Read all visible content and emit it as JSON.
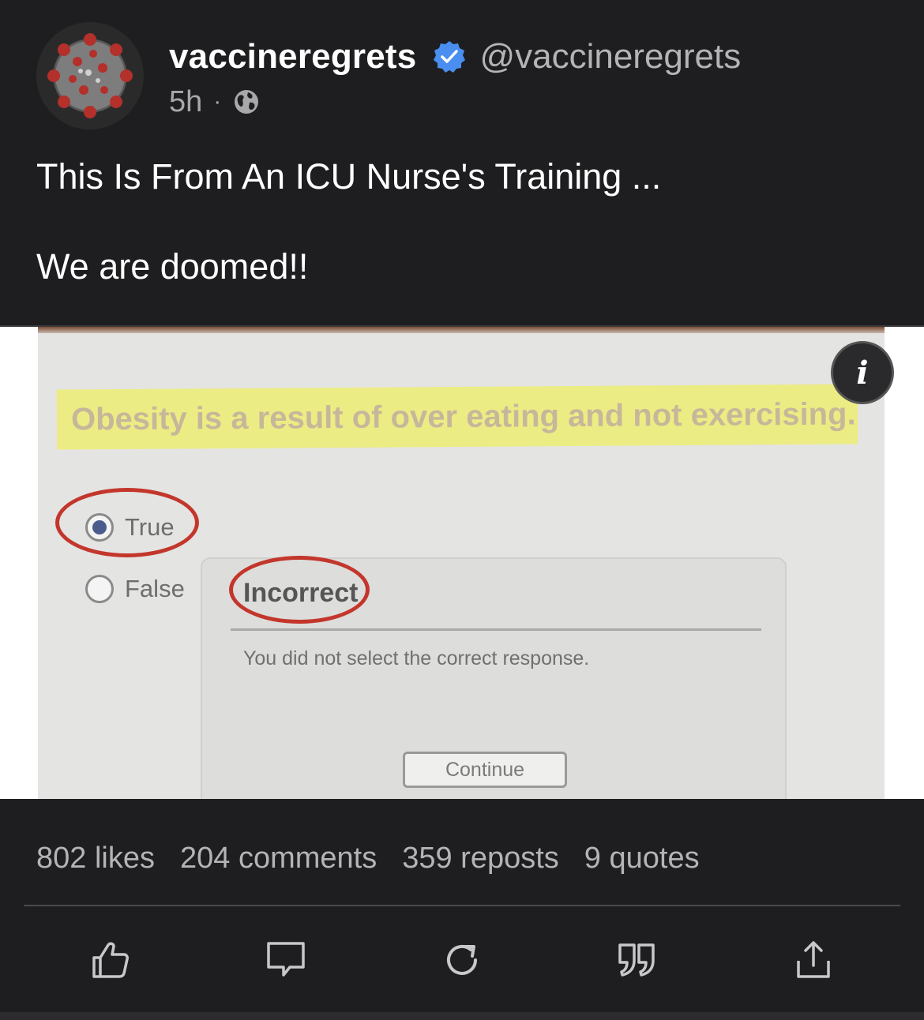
{
  "post": {
    "display_name": "vaccineregrets",
    "handle": "@vaccineregrets",
    "time_ago": "5h",
    "separator": "·",
    "visibility_icon": "globe-icon",
    "verified_icon": "verified-badge-icon",
    "text_line_1": "This Is From An ICU Nurse's Training ...",
    "text_line_2": "We are doomed!!"
  },
  "image": {
    "question": "Obesity is a result of over eating and not exercising.",
    "options": [
      {
        "label": "True",
        "selected": true
      },
      {
        "label": "False",
        "selected": false
      }
    ],
    "feedback_title": "Incorrect",
    "feedback_message": "You did not select the correct response.",
    "continue_label": "Continue",
    "info_label": "i"
  },
  "stats": {
    "likes": "802 likes",
    "comments": "204 comments",
    "reposts": "359 reposts",
    "quotes": "9 quotes"
  },
  "actions": [
    "like-icon",
    "comment-icon",
    "repost-icon",
    "quote-icon",
    "share-icon"
  ],
  "colors": {
    "background": "#1e1e20",
    "verified": "#4a8ef0",
    "highlight": "#ecec84",
    "annotation_red": "#c3362c"
  }
}
